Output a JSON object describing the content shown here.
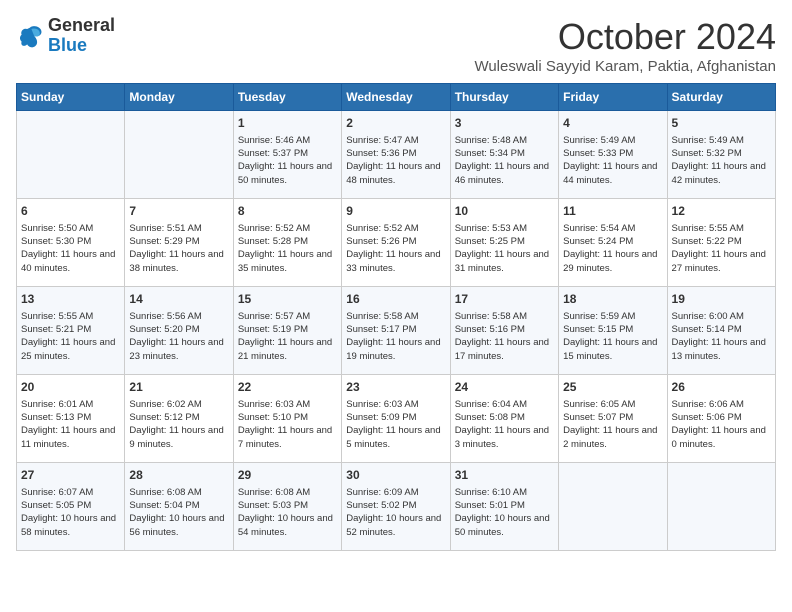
{
  "header": {
    "logo": {
      "general": "General",
      "blue": "Blue"
    },
    "title": "October 2024",
    "subtitle": "Wuleswali Sayyid Karam, Paktia, Afghanistan"
  },
  "calendar": {
    "headers": [
      "Sunday",
      "Monday",
      "Tuesday",
      "Wednesday",
      "Thursday",
      "Friday",
      "Saturday"
    ],
    "weeks": [
      [
        {
          "day": "",
          "info": ""
        },
        {
          "day": "",
          "info": ""
        },
        {
          "day": "1",
          "info": "Sunrise: 5:46 AM\nSunset: 5:37 PM\nDaylight: 11 hours and 50 minutes."
        },
        {
          "day": "2",
          "info": "Sunrise: 5:47 AM\nSunset: 5:36 PM\nDaylight: 11 hours and 48 minutes."
        },
        {
          "day": "3",
          "info": "Sunrise: 5:48 AM\nSunset: 5:34 PM\nDaylight: 11 hours and 46 minutes."
        },
        {
          "day": "4",
          "info": "Sunrise: 5:49 AM\nSunset: 5:33 PM\nDaylight: 11 hours and 44 minutes."
        },
        {
          "day": "5",
          "info": "Sunrise: 5:49 AM\nSunset: 5:32 PM\nDaylight: 11 hours and 42 minutes."
        }
      ],
      [
        {
          "day": "6",
          "info": "Sunrise: 5:50 AM\nSunset: 5:30 PM\nDaylight: 11 hours and 40 minutes."
        },
        {
          "day": "7",
          "info": "Sunrise: 5:51 AM\nSunset: 5:29 PM\nDaylight: 11 hours and 38 minutes."
        },
        {
          "day": "8",
          "info": "Sunrise: 5:52 AM\nSunset: 5:28 PM\nDaylight: 11 hours and 35 minutes."
        },
        {
          "day": "9",
          "info": "Sunrise: 5:52 AM\nSunset: 5:26 PM\nDaylight: 11 hours and 33 minutes."
        },
        {
          "day": "10",
          "info": "Sunrise: 5:53 AM\nSunset: 5:25 PM\nDaylight: 11 hours and 31 minutes."
        },
        {
          "day": "11",
          "info": "Sunrise: 5:54 AM\nSunset: 5:24 PM\nDaylight: 11 hours and 29 minutes."
        },
        {
          "day": "12",
          "info": "Sunrise: 5:55 AM\nSunset: 5:22 PM\nDaylight: 11 hours and 27 minutes."
        }
      ],
      [
        {
          "day": "13",
          "info": "Sunrise: 5:55 AM\nSunset: 5:21 PM\nDaylight: 11 hours and 25 minutes."
        },
        {
          "day": "14",
          "info": "Sunrise: 5:56 AM\nSunset: 5:20 PM\nDaylight: 11 hours and 23 minutes."
        },
        {
          "day": "15",
          "info": "Sunrise: 5:57 AM\nSunset: 5:19 PM\nDaylight: 11 hours and 21 minutes."
        },
        {
          "day": "16",
          "info": "Sunrise: 5:58 AM\nSunset: 5:17 PM\nDaylight: 11 hours and 19 minutes."
        },
        {
          "day": "17",
          "info": "Sunrise: 5:58 AM\nSunset: 5:16 PM\nDaylight: 11 hours and 17 minutes."
        },
        {
          "day": "18",
          "info": "Sunrise: 5:59 AM\nSunset: 5:15 PM\nDaylight: 11 hours and 15 minutes."
        },
        {
          "day": "19",
          "info": "Sunrise: 6:00 AM\nSunset: 5:14 PM\nDaylight: 11 hours and 13 minutes."
        }
      ],
      [
        {
          "day": "20",
          "info": "Sunrise: 6:01 AM\nSunset: 5:13 PM\nDaylight: 11 hours and 11 minutes."
        },
        {
          "day": "21",
          "info": "Sunrise: 6:02 AM\nSunset: 5:12 PM\nDaylight: 11 hours and 9 minutes."
        },
        {
          "day": "22",
          "info": "Sunrise: 6:03 AM\nSunset: 5:10 PM\nDaylight: 11 hours and 7 minutes."
        },
        {
          "day": "23",
          "info": "Sunrise: 6:03 AM\nSunset: 5:09 PM\nDaylight: 11 hours and 5 minutes."
        },
        {
          "day": "24",
          "info": "Sunrise: 6:04 AM\nSunset: 5:08 PM\nDaylight: 11 hours and 3 minutes."
        },
        {
          "day": "25",
          "info": "Sunrise: 6:05 AM\nSunset: 5:07 PM\nDaylight: 11 hours and 2 minutes."
        },
        {
          "day": "26",
          "info": "Sunrise: 6:06 AM\nSunset: 5:06 PM\nDaylight: 11 hours and 0 minutes."
        }
      ],
      [
        {
          "day": "27",
          "info": "Sunrise: 6:07 AM\nSunset: 5:05 PM\nDaylight: 10 hours and 58 minutes."
        },
        {
          "day": "28",
          "info": "Sunrise: 6:08 AM\nSunset: 5:04 PM\nDaylight: 10 hours and 56 minutes."
        },
        {
          "day": "29",
          "info": "Sunrise: 6:08 AM\nSunset: 5:03 PM\nDaylight: 10 hours and 54 minutes."
        },
        {
          "day": "30",
          "info": "Sunrise: 6:09 AM\nSunset: 5:02 PM\nDaylight: 10 hours and 52 minutes."
        },
        {
          "day": "31",
          "info": "Sunrise: 6:10 AM\nSunset: 5:01 PM\nDaylight: 10 hours and 50 minutes."
        },
        {
          "day": "",
          "info": ""
        },
        {
          "day": "",
          "info": ""
        }
      ]
    ]
  }
}
